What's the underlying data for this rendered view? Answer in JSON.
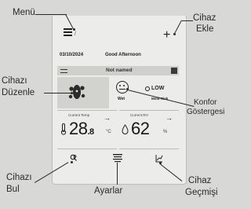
{
  "callouts": {
    "menu": "Menü",
    "add_device_line1": "Cihaz",
    "add_device_line2": "Ekle",
    "edit_device_line1": "Cihazı",
    "edit_device_line2": "Düzenle",
    "comfort_indicator_line1": "Konfor",
    "comfort_indicator_line2": "Göstergesi",
    "find_device_line1": "Cihazı",
    "find_device_line2": "Bul",
    "settings": "Ayarlar",
    "device_history_line1": "Cihaz",
    "device_history_line2": "Geçmişi"
  },
  "app": {
    "menu_mark": "/",
    "add_symbol": "+",
    "date": "03/10/2024",
    "greeting": "Good Afternoon",
    "device_name": "Not named",
    "comfort": {
      "face_label": "Wet",
      "level": "LOW",
      "level_sub": "Mold Risk"
    },
    "temperature": {
      "label": "Current Temp",
      "value_int": "28",
      "value_dec": ".8",
      "unit": "°C",
      "arrow": "→"
    },
    "humidity": {
      "label": "Current RH",
      "value_int": "62",
      "unit": "%",
      "arrow": "→"
    },
    "nav": {
      "find_icon": "find-device-icon",
      "settings_icon": "settings-icon",
      "history_icon": "history-icon"
    }
  }
}
